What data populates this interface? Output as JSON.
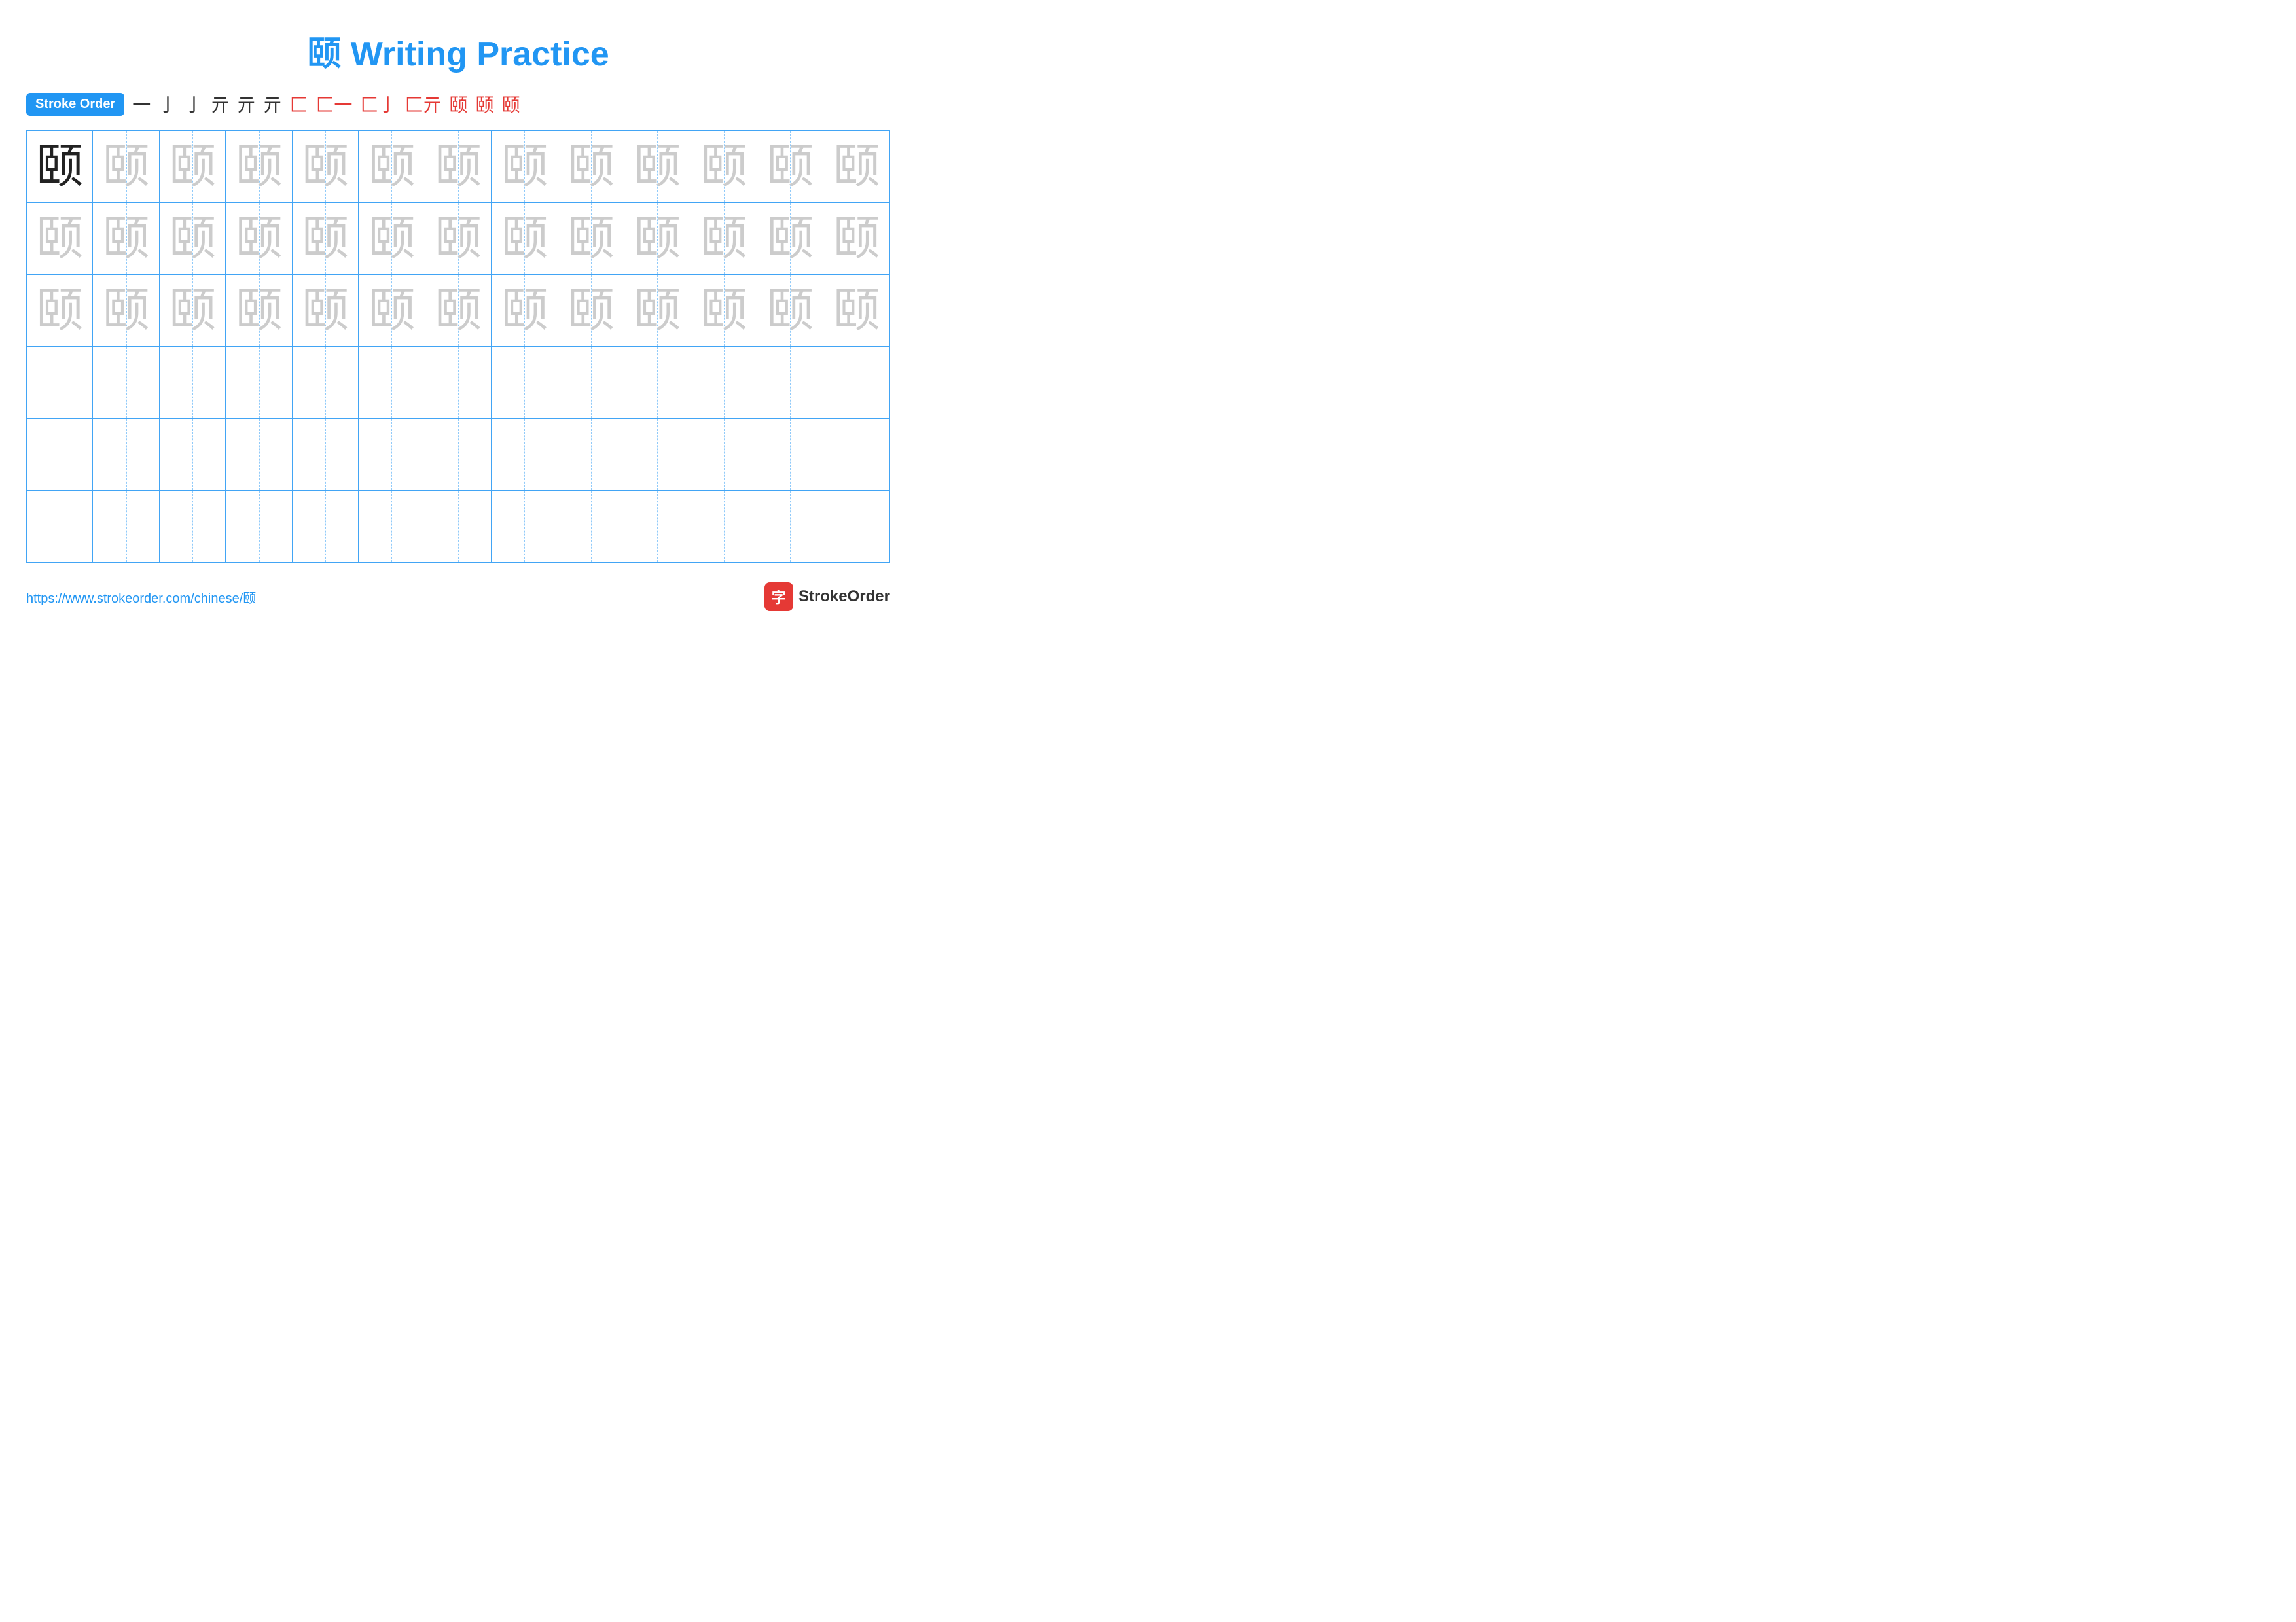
{
  "title": "颐 Writing Practice",
  "stroke_order": {
    "badge": "Stroke Order",
    "steps": [
      "一",
      "亅",
      "亅",
      "亓",
      "亓",
      "亓",
      "匚",
      "匚一",
      "匚亅",
      "匚亓",
      "颐",
      "颐",
      "颐"
    ]
  },
  "character": "颐",
  "rows": [
    {
      "type": "dark_then_light",
      "dark_count": 1,
      "total": 13
    },
    {
      "type": "all_light",
      "total": 13
    },
    {
      "type": "all_light",
      "total": 13
    },
    {
      "type": "empty",
      "total": 13
    },
    {
      "type": "empty",
      "total": 13
    },
    {
      "type": "empty",
      "total": 13
    }
  ],
  "footer": {
    "url": "https://www.strokeorder.com/chinese/颐",
    "brand": "StrokeOrder"
  }
}
